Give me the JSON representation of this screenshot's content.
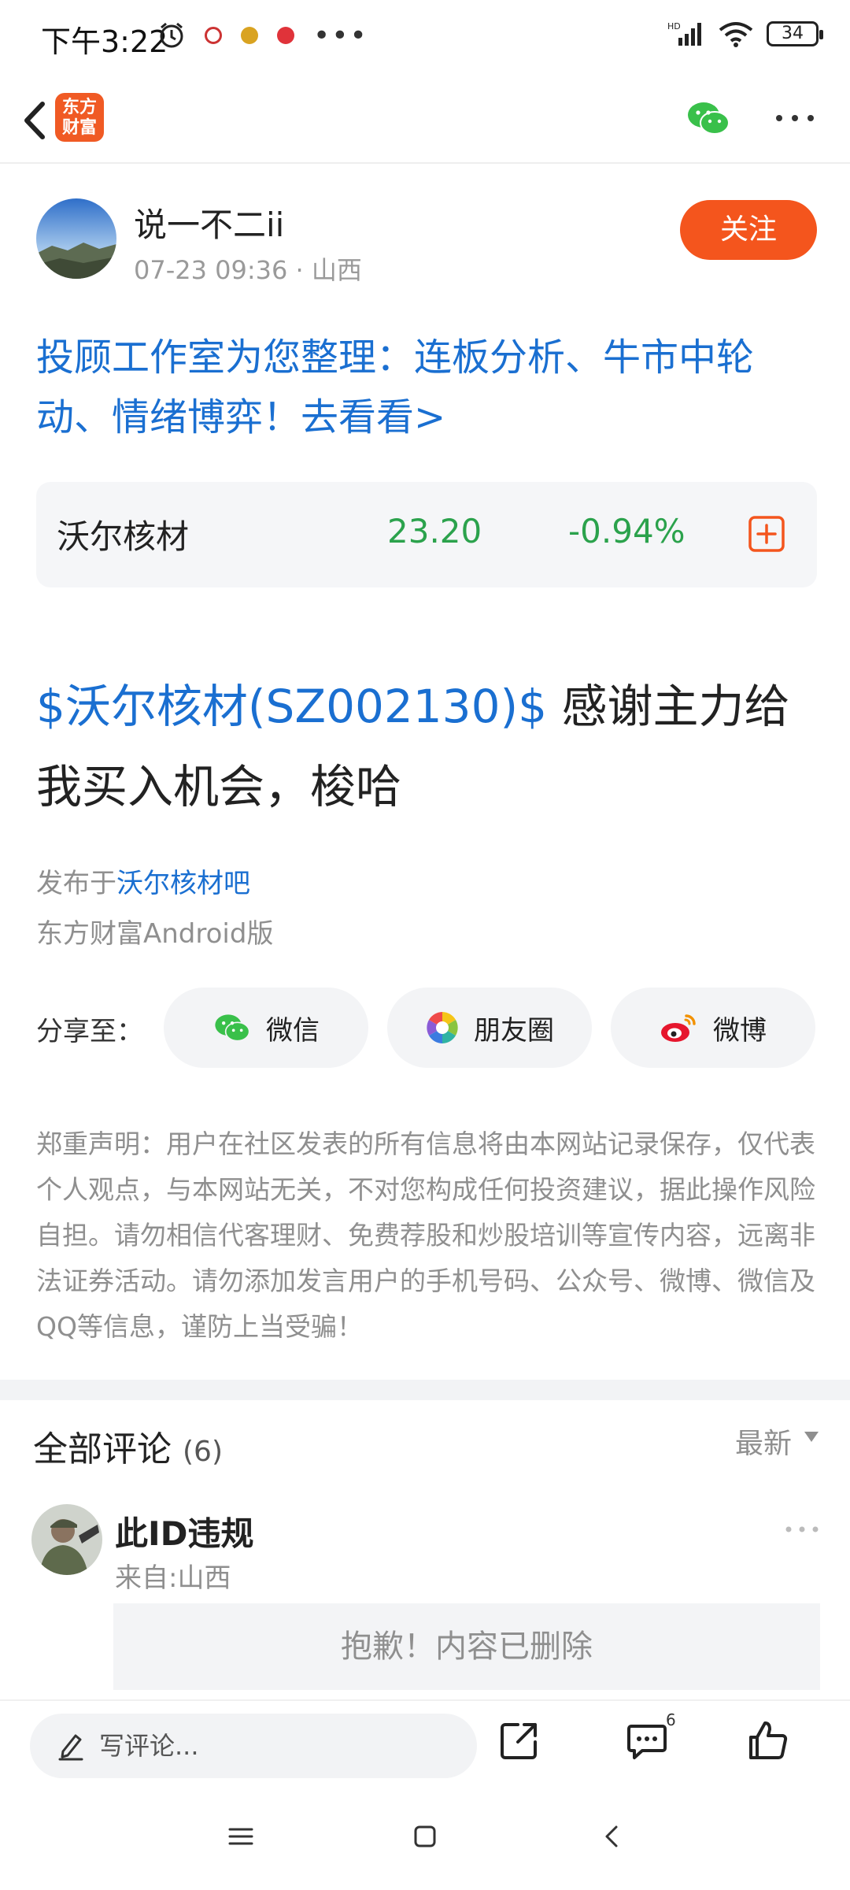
{
  "status_bar": {
    "time": "下午3:22",
    "battery": "34",
    "network": "HD"
  },
  "topnav": {
    "logo_text_line1": "东方",
    "logo_text_line2": "财富"
  },
  "author": {
    "name": "说一不二ii",
    "meta": "07-23 09:36 · 山西",
    "follow_label": "关注"
  },
  "promo": {
    "text": "投顾工作室为您整理：连板分析、牛市中轮动、情绪博弈！去看看>"
  },
  "stock": {
    "name": "沃尔核材",
    "price": "23.20",
    "change": "-0.94%",
    "change_color": "#2ba24c"
  },
  "post": {
    "tag": "$沃尔核材(SZ002130)$",
    "text": " 感谢主力给我买入机会，梭哈",
    "published_prefix": "发布于",
    "forum": "沃尔核材吧",
    "client": "东方财富Android版"
  },
  "share": {
    "label": "分享至：",
    "wechat": "微信",
    "moments": "朋友圈",
    "weibo": "微博"
  },
  "disclaimer": "郑重声明：用户在社区发表的所有信息将由本网站记录保存，仅代表个人观点，与本网站无关，不对您构成任何投资建议，据此操作风险自担。请勿相信代客理财、免费荐股和炒股培训等宣传内容，远离非法证券活动。请勿添加发言用户的手机号码、公众号、微博、微信及QQ等信息，谨防上当受骗！",
  "comments": {
    "title": "全部评论",
    "count": "(6)",
    "sort": "最新",
    "items": [
      {
        "user": "此ID违规",
        "location": "来自:山西",
        "content": "抱歉！内容已删除"
      }
    ]
  },
  "bottom_bar": {
    "input_placeholder": "写评论...",
    "comment_badge": "6"
  },
  "colors": {
    "accent": "#f4551d",
    "link": "#1a6fd1",
    "down": "#2ba24c"
  }
}
